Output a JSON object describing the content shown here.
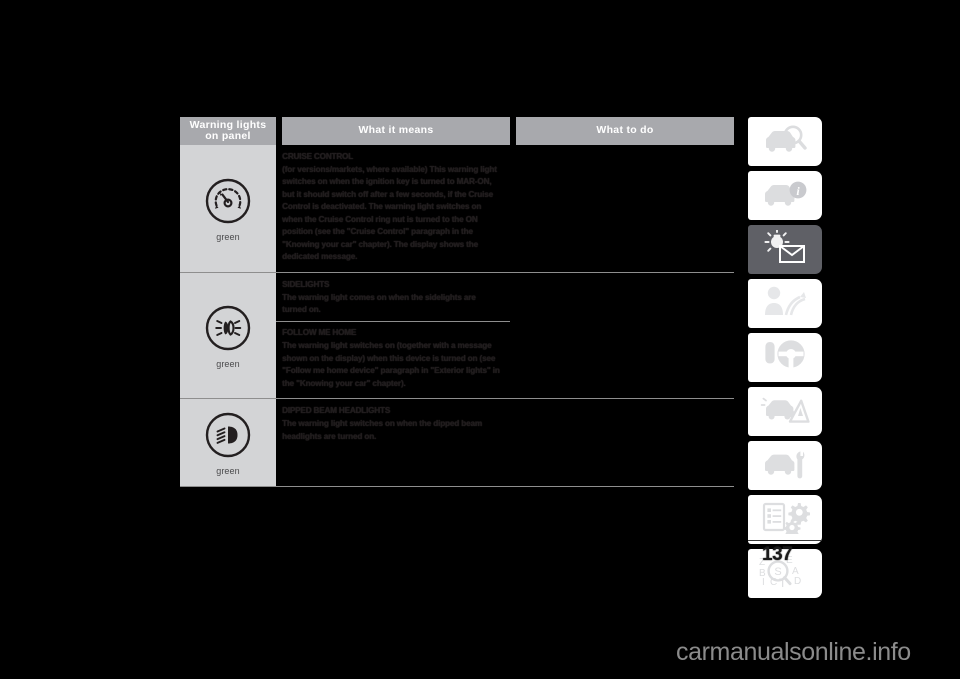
{
  "document": {
    "page_number": "137",
    "watermark": "carmanualsonline.info"
  },
  "table": {
    "headers": {
      "col1": "Warning lights on panel",
      "col2": "What it means",
      "col3": "What to do"
    },
    "rows": [
      {
        "icon_name": "cruise-control-icon",
        "color_label": "green",
        "blocks": [
          {
            "heading": "CRUISE CONTROL",
            "body": "(for versions/markets, where available)\nThis warning light switches on when the ignition key is turned to MAR-ON, but it should switch off after a few seconds, if the Cruise Control is deactivated.\nThe warning light switches on when the Cruise Control ring nut is turned to the ON position (see the \"Cruise Control\" paragraph in the \"Knowing your car\" chapter).\nThe display shows the dedicated message."
          }
        ],
        "what_to_do": ""
      },
      {
        "icon_name": "sidelights-icon",
        "color_label": "green",
        "blocks": [
          {
            "heading": "SIDELIGHTS",
            "body": "The warning light comes on when the sidelights are turned on."
          },
          {
            "heading": "FOLLOW ME HOME",
            "body": "The warning light switches on (together with a message shown on the display) when this device is turned on (see \"Follow me home device\" paragraph in \"Exterior lights\" in the \"Knowing your car\" chapter)."
          }
        ],
        "what_to_do": ""
      },
      {
        "icon_name": "dipped-beam-headlights-icon",
        "color_label": "green",
        "blocks": [
          {
            "heading": "DIPPED BEAM HEADLIGHTS",
            "body": "The warning light switches on when the dipped beam headlights are turned on."
          }
        ],
        "what_to_do": ""
      }
    ]
  },
  "tab_rail": {
    "tabs": [
      {
        "icon_name": "car-inspect-icon",
        "active": false
      },
      {
        "icon_name": "car-info-icon",
        "active": false
      },
      {
        "icon_name": "warning-light-mail-icon",
        "active": true
      },
      {
        "icon_name": "emergency-person-icon",
        "active": false
      },
      {
        "icon_name": "steering-wheel-icon",
        "active": false
      },
      {
        "icon_name": "accident-warning-icon",
        "active": false
      },
      {
        "icon_name": "car-service-icon",
        "active": false
      },
      {
        "icon_name": "specifications-gears-icon",
        "active": false
      },
      {
        "icon_name": "alphabetical-index-icon",
        "active": false
      }
    ]
  },
  "colors": {
    "header_bg": "#a8a9ad",
    "icon_cell_bg": "#d3d4d6",
    "active_tab_bg": "#5f6066",
    "page_bg": "#000000"
  }
}
